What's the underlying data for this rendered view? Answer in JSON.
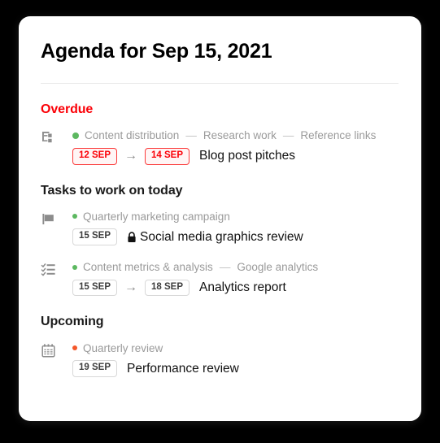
{
  "header": {
    "title": "Agenda for Sep 15, 2021"
  },
  "colors": {
    "overdue_red": "#fb0007",
    "badge_red_border": "#fb3b3b",
    "badge_red_bg": "#fff5f5",
    "badge_gray_border": "#d8d8d8",
    "dot_green": "#5cb860",
    "dot_orange": "#f4572a",
    "muted_text": "#9a9a9a",
    "card_bg": "#ffffff",
    "page_bg": "#000000"
  },
  "sections": [
    {
      "heading": "Overdue",
      "heading_style": "overdue",
      "tasks": [
        {
          "icon": "subtask-icon",
          "dot_color": "#5cb860",
          "dot_size": "large",
          "breadcrumb": [
            "Content distribution",
            "Research work",
            "Reference links"
          ],
          "separator": "—",
          "start_badge": "12 SEP",
          "end_badge": "14 SEP",
          "badge_style": "red",
          "arrow": "→",
          "title": "Blog post pitches",
          "locked": false
        }
      ]
    },
    {
      "heading": "Tasks to work on today",
      "heading_style": "normal",
      "tasks": [
        {
          "icon": "flag-icon",
          "dot_color": "#5cb860",
          "dot_size": "small",
          "breadcrumb": [
            "Quarterly marketing campaign"
          ],
          "separator": "—",
          "start_badge": "15 SEP",
          "end_badge": null,
          "badge_style": "gray",
          "arrow": null,
          "title": "Social media graphics review",
          "locked": true
        },
        {
          "icon": "checklist-icon",
          "dot_color": "#5cb860",
          "dot_size": "small",
          "breadcrumb": [
            "Content metrics & analysis",
            "Google analytics"
          ],
          "separator": "—",
          "start_badge": "15 SEP",
          "end_badge": "18 SEP",
          "badge_style": "gray",
          "arrow": "→",
          "title": "Analytics report",
          "locked": false
        }
      ]
    },
    {
      "heading": "Upcoming",
      "heading_style": "normal",
      "tasks": [
        {
          "icon": "calendar-icon",
          "dot_color": "#f4572a",
          "dot_size": "small",
          "breadcrumb": [
            "Quarterly review"
          ],
          "separator": "—",
          "start_badge": "19 SEP",
          "end_badge": null,
          "badge_style": "gray",
          "arrow": null,
          "title": "Performance review",
          "locked": false
        }
      ]
    }
  ]
}
